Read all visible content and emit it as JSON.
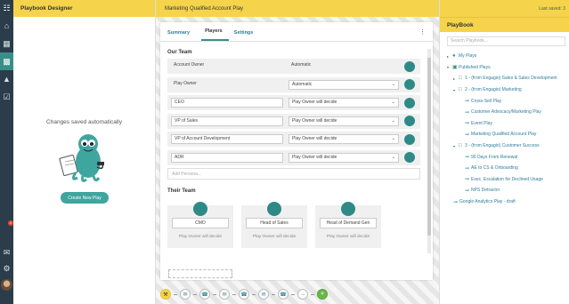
{
  "left_panel": {
    "title": "Playbook Designer",
    "saved_text": "Changes saved automatically",
    "create_button": "Create New Play"
  },
  "rail": {
    "notification_count": "1"
  },
  "center": {
    "play_title": "Marketing Qualified Account Play",
    "tabs": [
      "Summary",
      "Players",
      "Settings"
    ],
    "our_team": {
      "title": "Our Team",
      "rows": [
        {
          "role": "Account Owner",
          "rule": "Automatic",
          "editable": false
        },
        {
          "role": "Play Owner",
          "rule": "Automatic",
          "editable": true
        },
        {
          "role": "CEO",
          "rule": "Play Owner will decide",
          "editable": true
        },
        {
          "role": "VP of Sales",
          "rule": "Play Owner will decide",
          "editable": true
        },
        {
          "role": "VP of Account Development",
          "rule": "Play Owner will decide",
          "editable": true
        },
        {
          "role": "ADR",
          "rule": "Play Owner will decide",
          "editable": true
        }
      ],
      "add_placeholder": "Add Persona..."
    },
    "their_team": {
      "title": "Their Team",
      "cards": [
        {
          "name": "CMO",
          "decide": "Play Owner will decide"
        },
        {
          "name": "Head of Sales",
          "decide": "Play Owner will decide"
        },
        {
          "name": "Head of Demand Gen",
          "decide": "Play Owner will decide"
        }
      ]
    }
  },
  "toolbar": {
    "buttons": [
      "wrench-icon",
      "email-icon",
      "phone-icon",
      "email-icon",
      "phone-icon",
      "email-icon",
      "phone-icon",
      "arrow-icon",
      "plus-icon"
    ]
  },
  "right_panel": {
    "last_saved": "Last saved: 3",
    "title": "PlayBook",
    "search_placeholder": "Search Playbook...",
    "tree": [
      {
        "label": "My Plays",
        "level": 0,
        "type": "person"
      },
      {
        "label": "Published Plays",
        "level": 0,
        "type": "book"
      },
      {
        "label": "1 - (from Engagio) Sales & Sales Development",
        "level": 1,
        "type": "folder"
      },
      {
        "label": "2 - (from Engagio) Marketing",
        "level": 1,
        "type": "folder"
      },
      {
        "label": "Cross-Sell Play",
        "level": 2,
        "type": "play"
      },
      {
        "label": "Customer Advocacy/Marketing Play",
        "level": 2,
        "type": "play"
      },
      {
        "label": "Event Play",
        "level": 2,
        "type": "play"
      },
      {
        "label": "Marketing Qualified Account Play",
        "level": 2,
        "type": "play"
      },
      {
        "label": "3 - (from Engagio) Customer Success",
        "level": 1,
        "type": "folder"
      },
      {
        "label": "90 Days From Renewal",
        "level": 2,
        "type": "play"
      },
      {
        "label": "AE to CS & Onboarding",
        "level": 2,
        "type": "play"
      },
      {
        "label": "Exec. Escalation for Declined Usage",
        "level": 2,
        "type": "play"
      },
      {
        "label": "NPS Detractor",
        "level": 2,
        "type": "play"
      },
      {
        "label": "Google Analytics Play - draft",
        "level": 1,
        "type": "play"
      }
    ]
  }
}
